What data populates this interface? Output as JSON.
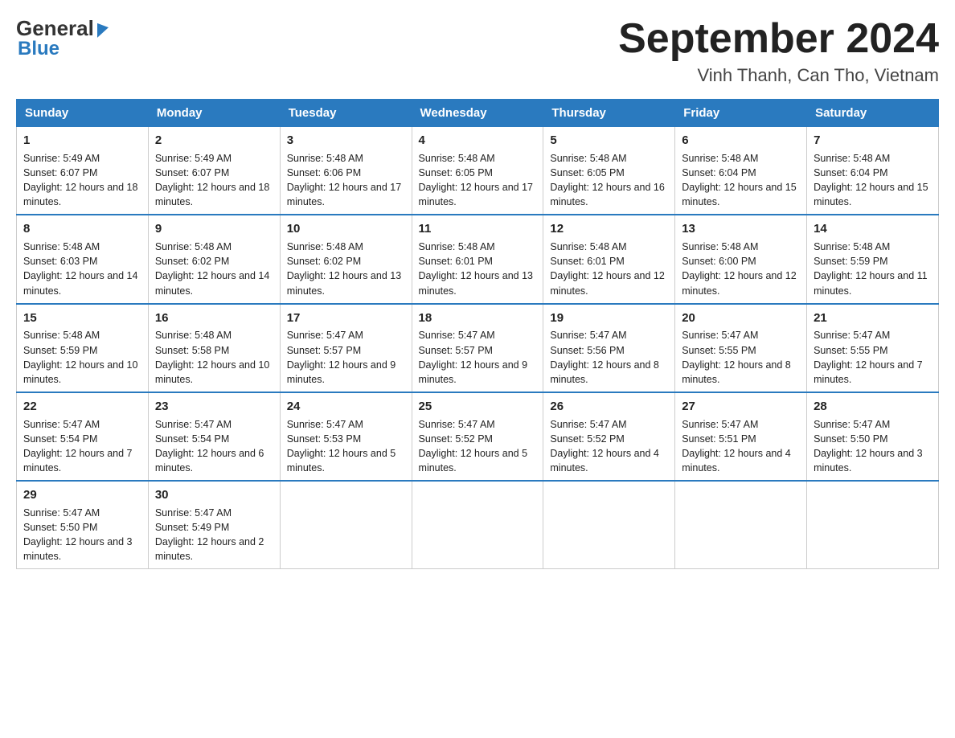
{
  "header": {
    "logo_general": "General",
    "logo_blue": "Blue",
    "main_title": "September 2024",
    "subtitle": "Vinh Thanh, Can Tho, Vietnam"
  },
  "days_of_week": [
    "Sunday",
    "Monday",
    "Tuesday",
    "Wednesday",
    "Thursday",
    "Friday",
    "Saturday"
  ],
  "weeks": [
    [
      {
        "day": "1",
        "sunrise": "Sunrise: 5:49 AM",
        "sunset": "Sunset: 6:07 PM",
        "daylight": "Daylight: 12 hours and 18 minutes."
      },
      {
        "day": "2",
        "sunrise": "Sunrise: 5:49 AM",
        "sunset": "Sunset: 6:07 PM",
        "daylight": "Daylight: 12 hours and 18 minutes."
      },
      {
        "day": "3",
        "sunrise": "Sunrise: 5:48 AM",
        "sunset": "Sunset: 6:06 PM",
        "daylight": "Daylight: 12 hours and 17 minutes."
      },
      {
        "day": "4",
        "sunrise": "Sunrise: 5:48 AM",
        "sunset": "Sunset: 6:05 PM",
        "daylight": "Daylight: 12 hours and 17 minutes."
      },
      {
        "day": "5",
        "sunrise": "Sunrise: 5:48 AM",
        "sunset": "Sunset: 6:05 PM",
        "daylight": "Daylight: 12 hours and 16 minutes."
      },
      {
        "day": "6",
        "sunrise": "Sunrise: 5:48 AM",
        "sunset": "Sunset: 6:04 PM",
        "daylight": "Daylight: 12 hours and 15 minutes."
      },
      {
        "day": "7",
        "sunrise": "Sunrise: 5:48 AM",
        "sunset": "Sunset: 6:04 PM",
        "daylight": "Daylight: 12 hours and 15 minutes."
      }
    ],
    [
      {
        "day": "8",
        "sunrise": "Sunrise: 5:48 AM",
        "sunset": "Sunset: 6:03 PM",
        "daylight": "Daylight: 12 hours and 14 minutes."
      },
      {
        "day": "9",
        "sunrise": "Sunrise: 5:48 AM",
        "sunset": "Sunset: 6:02 PM",
        "daylight": "Daylight: 12 hours and 14 minutes."
      },
      {
        "day": "10",
        "sunrise": "Sunrise: 5:48 AM",
        "sunset": "Sunset: 6:02 PM",
        "daylight": "Daylight: 12 hours and 13 minutes."
      },
      {
        "day": "11",
        "sunrise": "Sunrise: 5:48 AM",
        "sunset": "Sunset: 6:01 PM",
        "daylight": "Daylight: 12 hours and 13 minutes."
      },
      {
        "day": "12",
        "sunrise": "Sunrise: 5:48 AM",
        "sunset": "Sunset: 6:01 PM",
        "daylight": "Daylight: 12 hours and 12 minutes."
      },
      {
        "day": "13",
        "sunrise": "Sunrise: 5:48 AM",
        "sunset": "Sunset: 6:00 PM",
        "daylight": "Daylight: 12 hours and 12 minutes."
      },
      {
        "day": "14",
        "sunrise": "Sunrise: 5:48 AM",
        "sunset": "Sunset: 5:59 PM",
        "daylight": "Daylight: 12 hours and 11 minutes."
      }
    ],
    [
      {
        "day": "15",
        "sunrise": "Sunrise: 5:48 AM",
        "sunset": "Sunset: 5:59 PM",
        "daylight": "Daylight: 12 hours and 10 minutes."
      },
      {
        "day": "16",
        "sunrise": "Sunrise: 5:48 AM",
        "sunset": "Sunset: 5:58 PM",
        "daylight": "Daylight: 12 hours and 10 minutes."
      },
      {
        "day": "17",
        "sunrise": "Sunrise: 5:47 AM",
        "sunset": "Sunset: 5:57 PM",
        "daylight": "Daylight: 12 hours and 9 minutes."
      },
      {
        "day": "18",
        "sunrise": "Sunrise: 5:47 AM",
        "sunset": "Sunset: 5:57 PM",
        "daylight": "Daylight: 12 hours and 9 minutes."
      },
      {
        "day": "19",
        "sunrise": "Sunrise: 5:47 AM",
        "sunset": "Sunset: 5:56 PM",
        "daylight": "Daylight: 12 hours and 8 minutes."
      },
      {
        "day": "20",
        "sunrise": "Sunrise: 5:47 AM",
        "sunset": "Sunset: 5:55 PM",
        "daylight": "Daylight: 12 hours and 8 minutes."
      },
      {
        "day": "21",
        "sunrise": "Sunrise: 5:47 AM",
        "sunset": "Sunset: 5:55 PM",
        "daylight": "Daylight: 12 hours and 7 minutes."
      }
    ],
    [
      {
        "day": "22",
        "sunrise": "Sunrise: 5:47 AM",
        "sunset": "Sunset: 5:54 PM",
        "daylight": "Daylight: 12 hours and 7 minutes."
      },
      {
        "day": "23",
        "sunrise": "Sunrise: 5:47 AM",
        "sunset": "Sunset: 5:54 PM",
        "daylight": "Daylight: 12 hours and 6 minutes."
      },
      {
        "day": "24",
        "sunrise": "Sunrise: 5:47 AM",
        "sunset": "Sunset: 5:53 PM",
        "daylight": "Daylight: 12 hours and 5 minutes."
      },
      {
        "day": "25",
        "sunrise": "Sunrise: 5:47 AM",
        "sunset": "Sunset: 5:52 PM",
        "daylight": "Daylight: 12 hours and 5 minutes."
      },
      {
        "day": "26",
        "sunrise": "Sunrise: 5:47 AM",
        "sunset": "Sunset: 5:52 PM",
        "daylight": "Daylight: 12 hours and 4 minutes."
      },
      {
        "day": "27",
        "sunrise": "Sunrise: 5:47 AM",
        "sunset": "Sunset: 5:51 PM",
        "daylight": "Daylight: 12 hours and 4 minutes."
      },
      {
        "day": "28",
        "sunrise": "Sunrise: 5:47 AM",
        "sunset": "Sunset: 5:50 PM",
        "daylight": "Daylight: 12 hours and 3 minutes."
      }
    ],
    [
      {
        "day": "29",
        "sunrise": "Sunrise: 5:47 AM",
        "sunset": "Sunset: 5:50 PM",
        "daylight": "Daylight: 12 hours and 3 minutes."
      },
      {
        "day": "30",
        "sunrise": "Sunrise: 5:47 AM",
        "sunset": "Sunset: 5:49 PM",
        "daylight": "Daylight: 12 hours and 2 minutes."
      },
      {
        "day": "",
        "sunrise": "",
        "sunset": "",
        "daylight": ""
      },
      {
        "day": "",
        "sunrise": "",
        "sunset": "",
        "daylight": ""
      },
      {
        "day": "",
        "sunrise": "",
        "sunset": "",
        "daylight": ""
      },
      {
        "day": "",
        "sunrise": "",
        "sunset": "",
        "daylight": ""
      },
      {
        "day": "",
        "sunrise": "",
        "sunset": "",
        "daylight": ""
      }
    ]
  ],
  "colors": {
    "header_bg": "#2a7abf",
    "header_text": "#ffffff",
    "border": "#cccccc"
  }
}
